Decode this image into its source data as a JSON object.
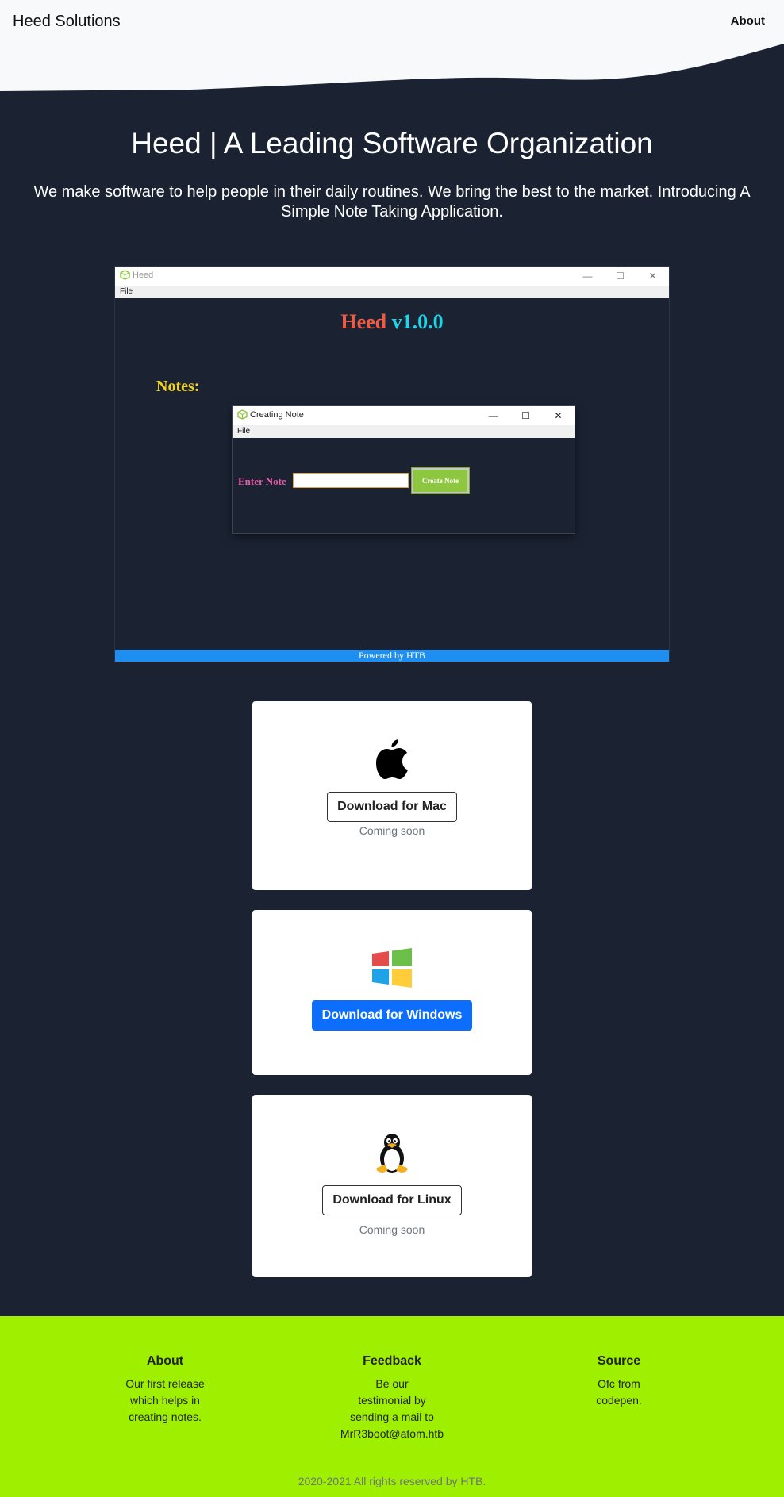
{
  "nav": {
    "brand": "Heed Solutions",
    "about": "About"
  },
  "hero": {
    "title": "Heed | A Leading Software Organization",
    "subtitle": "We make software to help people in their daily routines. We bring the best to the market. Introducing A Simple Note Taking Application."
  },
  "app_screenshot": {
    "window_title": "Heed",
    "menu": "File",
    "heading_name": "Heed",
    "heading_version": "v1.0.0",
    "notes_label": "Notes:",
    "dialog": {
      "window_title": "Creating Note",
      "menu": "File",
      "enter_note_label": "Enter Note",
      "create_button": "Create Note"
    },
    "footer_bar": "Powered by HTB"
  },
  "downloads": {
    "mac": {
      "button": "Download for Mac",
      "note": "Coming soon",
      "icon": "apple-icon"
    },
    "windows": {
      "button": "Download for Windows",
      "icon": "windows-icon"
    },
    "linux": {
      "button": "Download for Linux",
      "note": "Coming soon",
      "icon": "tux-icon"
    }
  },
  "footer": {
    "about": {
      "title": "About",
      "lines": [
        "Our first release",
        "which helps in",
        "creating notes."
      ]
    },
    "feedback": {
      "title": "Feedback",
      "lines": [
        "Be our",
        "testimonial by",
        "sending a mail to",
        "MrR3boot@atom.htb"
      ]
    },
    "source": {
      "title": "Source",
      "lines": [
        "Ofc from",
        "codepen."
      ]
    },
    "copyright": "2020-2021 All rights reserved by HTB."
  },
  "colors": {
    "background": "#1b2333",
    "header": "#f7f9fb",
    "footer": "#9ef000",
    "primary_button": "#0d6efd",
    "powered_bar": "#1e8ff0"
  }
}
